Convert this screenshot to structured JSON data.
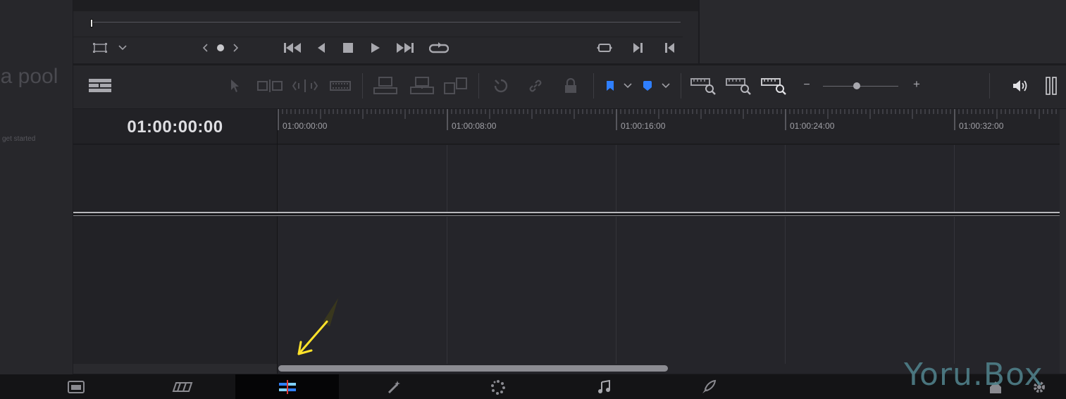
{
  "media_pool": {
    "title": "ia pool",
    "hint": "get started"
  },
  "timeline": {
    "timecode": "01:00:00:00",
    "ruler_labels": [
      "01:00:00:00",
      "01:00:08:00",
      "01:00:16:00",
      "01:00:24:00",
      "01:00:32:00"
    ]
  },
  "toolbar": {
    "zoom_minus": "−",
    "zoom_plus": "+",
    "zoom_level": 0.45
  },
  "watermark": "Yoru.Box",
  "colors": {
    "accent_blue": "#2f7fff",
    "annotation_yellow": "#ffe22a",
    "edit_page_marker": "#e03a3a"
  },
  "icons": {
    "viewer": [
      "viewer-size-icon",
      "chevron-down-icon",
      "prev-icon",
      "dot-icon",
      "next-icon",
      "go-to-start-icon",
      "play-reverse-icon",
      "stop-icon",
      "play-icon",
      "go-to-end-icon",
      "loop-icon",
      "match-frame-icon",
      "mark-in-icon",
      "mark-out-icon"
    ],
    "toolbar": [
      "timeline-view-options-icon",
      "selection-mode-icon",
      "trim-edit-icon",
      "dynamic-trim-icon",
      "blade-edit-icon",
      "insert-clip-icon",
      "overwrite-clip-icon",
      "replace-clip-icon",
      "snapping-icon",
      "linked-selection-icon",
      "position-lock-icon",
      "flag-icon",
      "marker-icon",
      "full-extent-zoom-icon",
      "detail-zoom-icon",
      "custom-zoom-icon",
      "volume-icon",
      "mute-icon"
    ],
    "pages": [
      "media-page-icon",
      "cut-page-icon",
      "edit-page-icon",
      "fusion-page-icon",
      "color-page-icon",
      "fairlight-page-icon",
      "deliver-page-icon",
      "home-icon",
      "settings-icon"
    ]
  }
}
